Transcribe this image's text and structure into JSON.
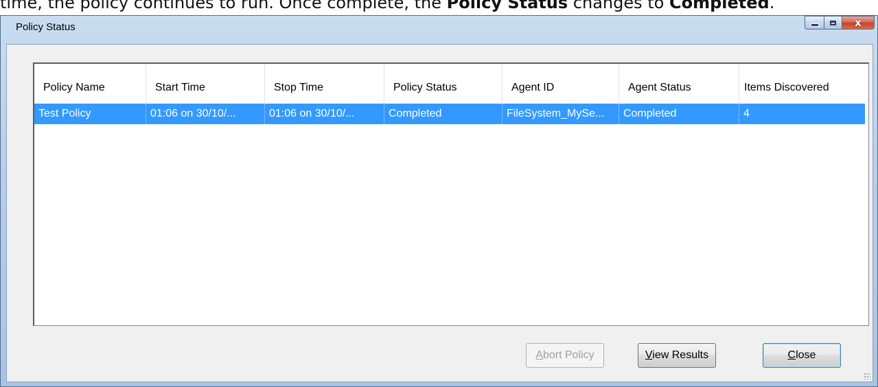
{
  "doc": {
    "prefix": "time, the policy continues to run. Once complete, the ",
    "bold1": "Policy Status",
    "middle": " changes to ",
    "bold2": "Completed",
    "suffix": "."
  },
  "window": {
    "title": "Policy Status",
    "close_glyph": "x"
  },
  "columns": [
    {
      "label": "Policy Name"
    },
    {
      "label": "Start Time"
    },
    {
      "label": "Stop Time"
    },
    {
      "label": "Policy Status"
    },
    {
      "label": "Agent ID"
    },
    {
      "label": "Agent Status"
    },
    {
      "label": "Items Discovered"
    }
  ],
  "rows": [
    {
      "cells": [
        "Test Policy",
        "01:06 on 30/10/...",
        "01:06 on 30/10/...",
        "Completed",
        "FileSystem_MySe...",
        "Completed",
        "4"
      ],
      "selected": true
    }
  ],
  "buttons": {
    "abort": {
      "label": "Abort Policy",
      "mnemonic": "A",
      "enabled": false
    },
    "view": {
      "label": "View Results",
      "mnemonic": "V",
      "enabled": true
    },
    "close": {
      "label": "Close",
      "mnemonic": "C",
      "enabled": true
    }
  },
  "colors": {
    "selection": "#3399ff",
    "title_bar": "#b7cfe8",
    "close_button": "#c2452a"
  },
  "icons": [
    "minimize-icon",
    "maximize-icon",
    "close-icon",
    "resize-grip-icon"
  ]
}
